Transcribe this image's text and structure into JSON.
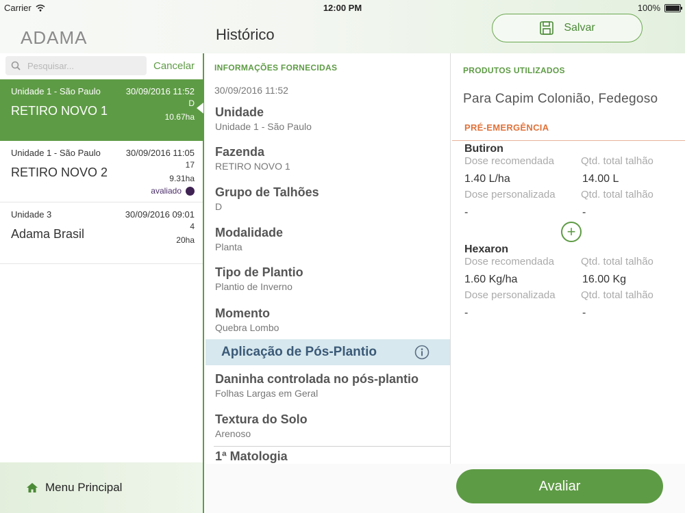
{
  "status_bar": {
    "carrier": "Carrier",
    "time": "12:00 PM",
    "battery": "100%"
  },
  "header": {
    "logo": "ADAMA",
    "title": "Histórico",
    "save_label": "Salvar"
  },
  "search": {
    "placeholder": "Pesquisar...",
    "cancel_label": "Cancelar"
  },
  "history_items": [
    {
      "unit": "Unidade 1 - São Paulo",
      "date": "30/09/2016 11:52",
      "name": "RETIRO NOVO 1",
      "code": "D",
      "area": "10.67ha",
      "selected": true
    },
    {
      "unit": "Unidade 1 - São Paulo",
      "date": "30/09/2016 11:05",
      "name": "RETIRO NOVO 2",
      "code": "17",
      "area": "9.31ha",
      "status": "avaliado"
    },
    {
      "unit": "Unidade 3",
      "date": "30/09/2016 09:01",
      "name": "Adama Brasil",
      "code": "4",
      "area": "20ha"
    }
  ],
  "menu": {
    "label": "Menu Principal"
  },
  "info": {
    "section_title": "INFORMAÇÕES FORNECIDAS",
    "date": "30/09/2016 11:52",
    "fields": [
      {
        "label": "Unidade",
        "value": "Unidade 1 - São Paulo"
      },
      {
        "label": "Fazenda",
        "value": "RETIRO NOVO 1"
      },
      {
        "label": "Grupo de Talhões",
        "value": "D"
      },
      {
        "label": "Modalidade",
        "value": "Planta"
      },
      {
        "label": "Tipo de Plantio",
        "value": "Plantio de Inverno"
      },
      {
        "label": "Momento",
        "value": "Quebra Lombo"
      }
    ],
    "post_section": "Aplicação de Pós-Plantio",
    "post_fields": [
      {
        "label": "Daninha controlada no pós-plantio",
        "value": "Folhas Largas em Geral"
      },
      {
        "label": "Textura do Solo",
        "value": "Arenoso"
      },
      {
        "label": "1ª Matologia",
        "value": ""
      }
    ]
  },
  "products": {
    "section_title": "PRODUTOS UTILIZADOS",
    "target": "Para Capim Colonião, Fedegoso",
    "pre_title": "PRÉ-EMERGÊNCIA",
    "items": [
      {
        "name": "Butiron",
        "dose_rec_label": "Dose recomendada",
        "qty_label": "Qtd. total talhão",
        "dose_rec": "1.40 L/ha",
        "qty": "14.00 L",
        "dose_custom_label": "Dose personalizada",
        "qty_custom_label": "Qtd. total talhão",
        "dose_custom": "-",
        "qty_custom": "-"
      },
      {
        "name": "Hexaron",
        "dose_rec_label": "Dose recomendada",
        "qty_label": "Qtd. total talhão",
        "dose_rec": "1.60 Kg/ha",
        "qty": "16.00 Kg",
        "dose_custom_label": "Dose personalizada",
        "qty_custom_label": "Qtd. total talhão",
        "dose_custom": "-",
        "qty_custom": "-"
      }
    ],
    "add_label": "+"
  },
  "actions": {
    "evaluate_label": "Avaliar"
  },
  "colors": {
    "brand_green": "#5e9b45",
    "accent_orange": "#e0723a",
    "section_blue": "#d7e8ee"
  }
}
